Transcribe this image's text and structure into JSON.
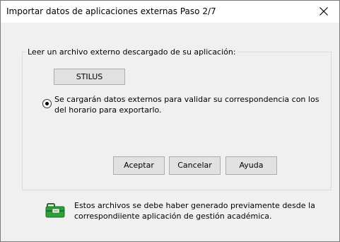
{
  "window": {
    "title": "Importar datos de aplicaciones externas Paso 2/7"
  },
  "group": {
    "label": "Leer un archivo externo descargado de su aplicación:",
    "source_button_label": "STILUS",
    "radio_text": "Se cargarán datos externos para validar su correspondencia con los del horario para exportarlo."
  },
  "buttons": {
    "accept": "Aceptar",
    "cancel": "Cancelar",
    "help": "Ayuda"
  },
  "info": {
    "icon": "green-briefcase-icon",
    "text": "Estos archivos se debe haber generado previamente desde la correspondiiente aplicación de gestión académica."
  },
  "colors": {
    "titlebar": "#ffffff",
    "dialog_bg": "#f0f0f0",
    "button_bg": "#e1e1e1",
    "icon_green": "#2e9e3a"
  }
}
